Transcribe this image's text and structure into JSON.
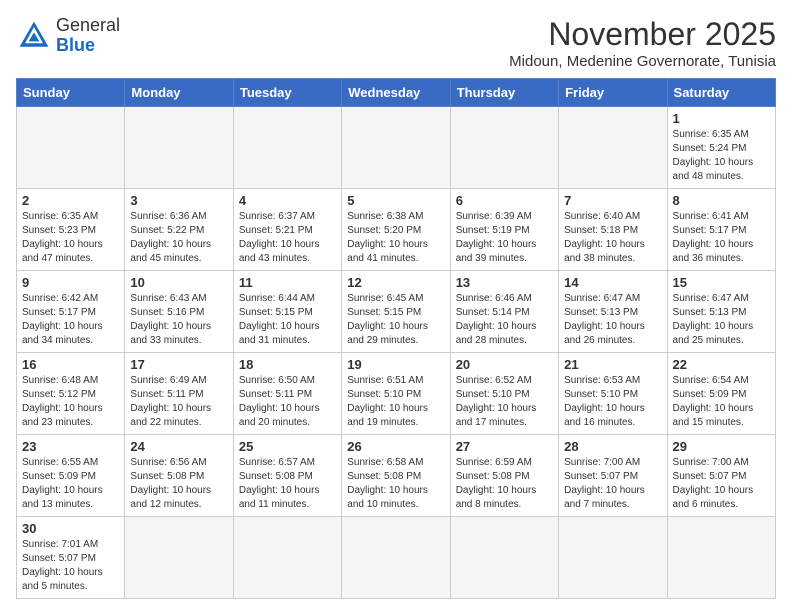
{
  "header": {
    "logo_general": "General",
    "logo_blue": "Blue",
    "month_year": "November 2025",
    "location": "Midoun, Medenine Governorate, Tunisia"
  },
  "days_of_week": [
    "Sunday",
    "Monday",
    "Tuesday",
    "Wednesday",
    "Thursday",
    "Friday",
    "Saturday"
  ],
  "weeks": [
    [
      {
        "day": "",
        "info": ""
      },
      {
        "day": "",
        "info": ""
      },
      {
        "day": "",
        "info": ""
      },
      {
        "day": "",
        "info": ""
      },
      {
        "day": "",
        "info": ""
      },
      {
        "day": "",
        "info": ""
      },
      {
        "day": "1",
        "info": "Sunrise: 6:35 AM\nSunset: 5:24 PM\nDaylight: 10 hours\nand 48 minutes."
      }
    ],
    [
      {
        "day": "2",
        "info": "Sunrise: 6:35 AM\nSunset: 5:23 PM\nDaylight: 10 hours\nand 47 minutes."
      },
      {
        "day": "3",
        "info": "Sunrise: 6:36 AM\nSunset: 5:22 PM\nDaylight: 10 hours\nand 45 minutes."
      },
      {
        "day": "4",
        "info": "Sunrise: 6:37 AM\nSunset: 5:21 PM\nDaylight: 10 hours\nand 43 minutes."
      },
      {
        "day": "5",
        "info": "Sunrise: 6:38 AM\nSunset: 5:20 PM\nDaylight: 10 hours\nand 41 minutes."
      },
      {
        "day": "6",
        "info": "Sunrise: 6:39 AM\nSunset: 5:19 PM\nDaylight: 10 hours\nand 39 minutes."
      },
      {
        "day": "7",
        "info": "Sunrise: 6:40 AM\nSunset: 5:18 PM\nDaylight: 10 hours\nand 38 minutes."
      },
      {
        "day": "8",
        "info": "Sunrise: 6:41 AM\nSunset: 5:17 PM\nDaylight: 10 hours\nand 36 minutes."
      }
    ],
    [
      {
        "day": "9",
        "info": "Sunrise: 6:42 AM\nSunset: 5:17 PM\nDaylight: 10 hours\nand 34 minutes."
      },
      {
        "day": "10",
        "info": "Sunrise: 6:43 AM\nSunset: 5:16 PM\nDaylight: 10 hours\nand 33 minutes."
      },
      {
        "day": "11",
        "info": "Sunrise: 6:44 AM\nSunset: 5:15 PM\nDaylight: 10 hours\nand 31 minutes."
      },
      {
        "day": "12",
        "info": "Sunrise: 6:45 AM\nSunset: 5:15 PM\nDaylight: 10 hours\nand 29 minutes."
      },
      {
        "day": "13",
        "info": "Sunrise: 6:46 AM\nSunset: 5:14 PM\nDaylight: 10 hours\nand 28 minutes."
      },
      {
        "day": "14",
        "info": "Sunrise: 6:47 AM\nSunset: 5:13 PM\nDaylight: 10 hours\nand 26 minutes."
      },
      {
        "day": "15",
        "info": "Sunrise: 6:47 AM\nSunset: 5:13 PM\nDaylight: 10 hours\nand 25 minutes."
      }
    ],
    [
      {
        "day": "16",
        "info": "Sunrise: 6:48 AM\nSunset: 5:12 PM\nDaylight: 10 hours\nand 23 minutes."
      },
      {
        "day": "17",
        "info": "Sunrise: 6:49 AM\nSunset: 5:11 PM\nDaylight: 10 hours\nand 22 minutes."
      },
      {
        "day": "18",
        "info": "Sunrise: 6:50 AM\nSunset: 5:11 PM\nDaylight: 10 hours\nand 20 minutes."
      },
      {
        "day": "19",
        "info": "Sunrise: 6:51 AM\nSunset: 5:10 PM\nDaylight: 10 hours\nand 19 minutes."
      },
      {
        "day": "20",
        "info": "Sunrise: 6:52 AM\nSunset: 5:10 PM\nDaylight: 10 hours\nand 17 minutes."
      },
      {
        "day": "21",
        "info": "Sunrise: 6:53 AM\nSunset: 5:10 PM\nDaylight: 10 hours\nand 16 minutes."
      },
      {
        "day": "22",
        "info": "Sunrise: 6:54 AM\nSunset: 5:09 PM\nDaylight: 10 hours\nand 15 minutes."
      }
    ],
    [
      {
        "day": "23",
        "info": "Sunrise: 6:55 AM\nSunset: 5:09 PM\nDaylight: 10 hours\nand 13 minutes."
      },
      {
        "day": "24",
        "info": "Sunrise: 6:56 AM\nSunset: 5:08 PM\nDaylight: 10 hours\nand 12 minutes."
      },
      {
        "day": "25",
        "info": "Sunrise: 6:57 AM\nSunset: 5:08 PM\nDaylight: 10 hours\nand 11 minutes."
      },
      {
        "day": "26",
        "info": "Sunrise: 6:58 AM\nSunset: 5:08 PM\nDaylight: 10 hours\nand 10 minutes."
      },
      {
        "day": "27",
        "info": "Sunrise: 6:59 AM\nSunset: 5:08 PM\nDaylight: 10 hours\nand 8 minutes."
      },
      {
        "day": "28",
        "info": "Sunrise: 7:00 AM\nSunset: 5:07 PM\nDaylight: 10 hours\nand 7 minutes."
      },
      {
        "day": "29",
        "info": "Sunrise: 7:00 AM\nSunset: 5:07 PM\nDaylight: 10 hours\nand 6 minutes."
      }
    ],
    [
      {
        "day": "30",
        "info": "Sunrise: 7:01 AM\nSunset: 5:07 PM\nDaylight: 10 hours\nand 5 minutes."
      },
      {
        "day": "",
        "info": ""
      },
      {
        "day": "",
        "info": ""
      },
      {
        "day": "",
        "info": ""
      },
      {
        "day": "",
        "info": ""
      },
      {
        "day": "",
        "info": ""
      },
      {
        "day": "",
        "info": ""
      }
    ]
  ]
}
